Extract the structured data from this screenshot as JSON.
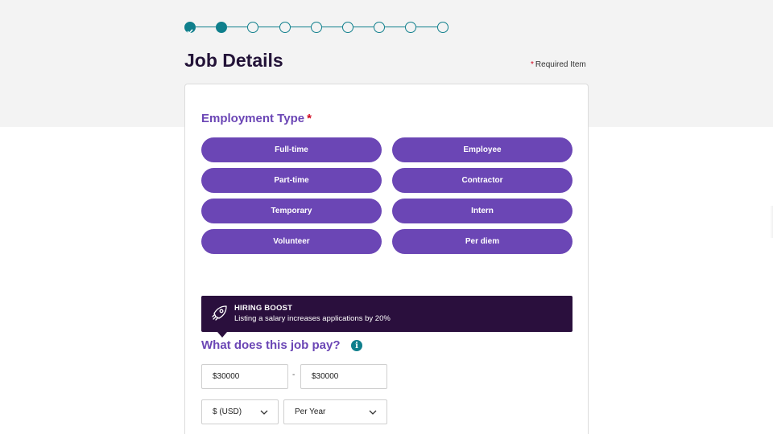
{
  "stepper": {
    "total_steps": 9,
    "completed_steps": 1,
    "current_step": 2
  },
  "page": {
    "title": "Job Details",
    "required_note": "Required Item",
    "required_star": "*"
  },
  "employment": {
    "heading": "Employment Type",
    "required_star": "*",
    "options": [
      "Full-time",
      "Employee",
      "Part-time",
      "Contractor",
      "Temporary",
      "Intern",
      "Volunteer",
      "Per diem"
    ]
  },
  "boost": {
    "icon": "rocket-icon",
    "title": "HIRING BOOST",
    "text": "Listing a salary increases applications by 20%"
  },
  "pay": {
    "heading": "What does this job pay?",
    "info_icon": "i",
    "min_value": "$30000",
    "separator": "-",
    "max_value": "$30000",
    "currency": "$ (USD)",
    "period": "Per Year"
  },
  "colors": {
    "accent": "#6b46b5",
    "teal": "#0f7f8c",
    "dark": "#2a0f3d",
    "required": "#d0021b"
  }
}
